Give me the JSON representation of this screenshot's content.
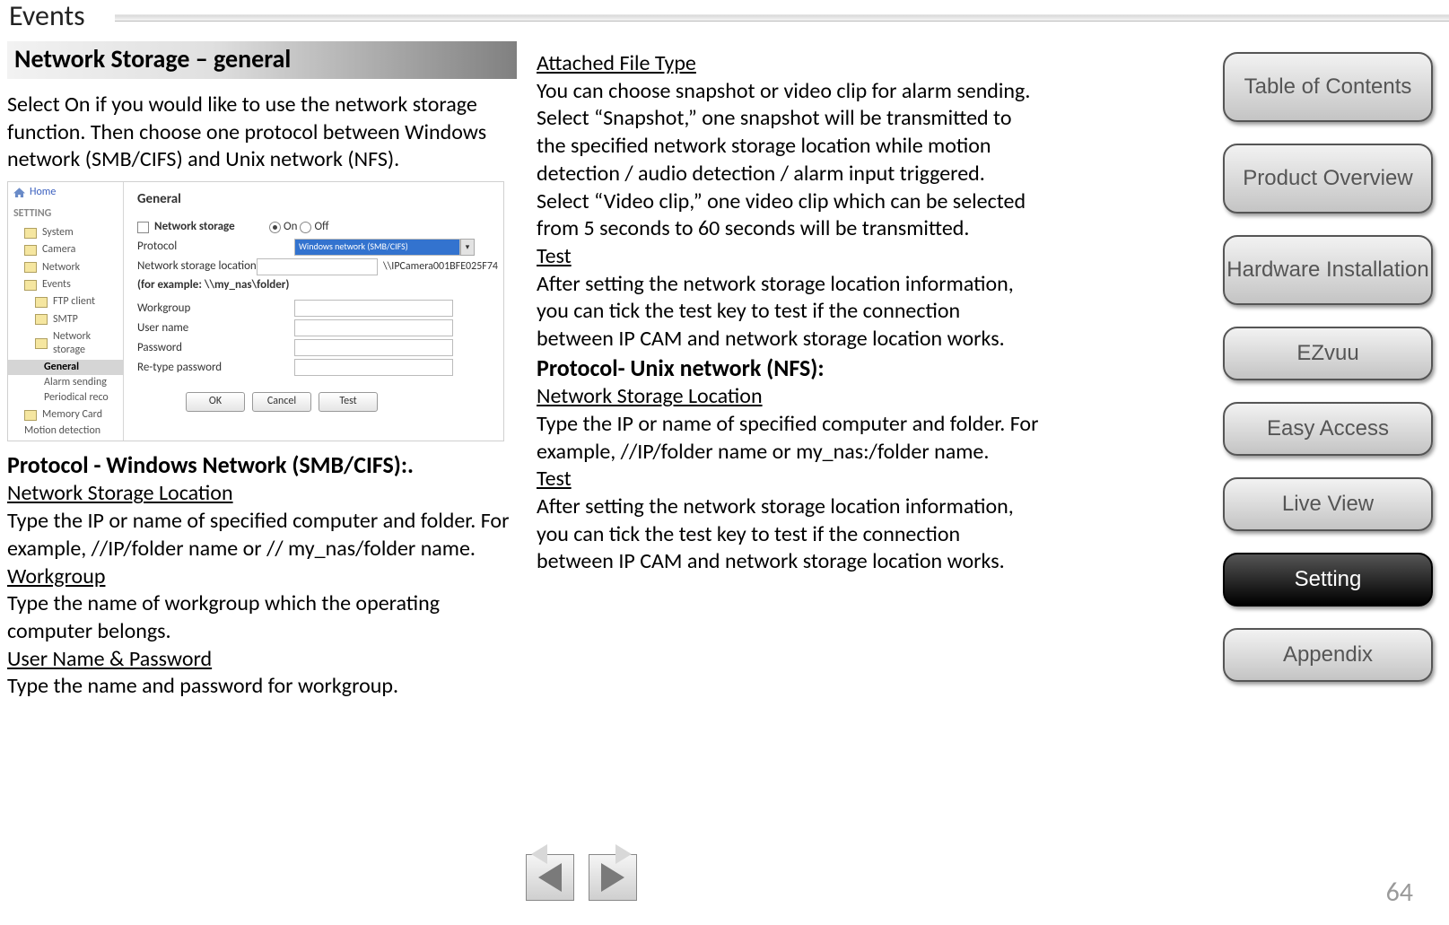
{
  "header": {
    "title": "Events"
  },
  "left": {
    "section_title": "Network Storage – general",
    "intro": "Select On if you would like to use the network storage function. Then choose one protocol between Windows network (SMB/CIFS) and Unix network (NFS).",
    "h_protocol_smb": "Protocol - Windows Network (SMB/CIFS):.",
    "h_nsl": "Network Storage Location",
    "p_nsl": "Type the IP or name of specified computer and folder. For example, //IP/folder name or // my_nas/folder name.",
    "h_wg": "Workgroup",
    "p_wg": "Type the name of workgroup which the operating computer belongs.",
    "h_up": "User Name & Password",
    "p_up": "Type the name and password for workgroup."
  },
  "right": {
    "h_aft": "Attached File Type",
    "p_aft": "You can choose snapshot or video clip for alarm sending. Select “Snapshot,” one snapshot will be transmitted to the specified network storage location while motion detection / audio detection / alarm input triggered. Select “Video clip,” one video clip which can be selected from 5 seconds to 60 seconds will be transmitted.",
    "h_test1": "Test",
    "p_test1": "After setting the network storage location information, you can tick the test key to test if the connection between IP CAM and network storage location works.",
    "h_nfs": "Protocol- Unix network (NFS):",
    "h_nsl2": "Network Storage Location",
    "p_nsl2": "Type the IP or name of specified computer and folder. For example, //IP/folder name or my_nas:/folder name.",
    "h_test2": "Test",
    "p_test2": "After setting the network storage location information, you can tick the test key to test if the connection between IP CAM and network storage location works."
  },
  "shot": {
    "side": {
      "home": "Home",
      "setting": "SETTING",
      "items": [
        "System",
        "Camera",
        "Network",
        "Events"
      ],
      "sub": [
        "FTP client",
        "SMTP",
        "Network storage"
      ],
      "ns_sub": [
        "General",
        "Alarm sending",
        "Periodical reco"
      ],
      "tail": [
        "Memory Card",
        "Motion detection"
      ]
    },
    "main": {
      "title": "General",
      "ns_label": "Network storage",
      "on": "On",
      "off": "Off",
      "protocol_lbl": "Protocol",
      "protocol_val": "Windows network (SMB/CIFS)",
      "nsl_lbl": "Network storage location",
      "nsl_val": "\\\\IPCamera001BFE025F74",
      "example": "(for example: \\\\my_nas\\folder)",
      "wg_lbl": "Workgroup",
      "un_lbl": "User name",
      "pw_lbl": "Password",
      "rpw_lbl": "Re-type password",
      "btn_ok": "OK",
      "btn_cancel": "Cancel",
      "btn_test": "Test"
    }
  },
  "nav": {
    "items": [
      {
        "label": "Table of Contents",
        "key": "toc",
        "lines": 2
      },
      {
        "label": "Product Overview",
        "key": "product",
        "lines": 2
      },
      {
        "label": "Hardware Installation",
        "key": "hw",
        "lines": 2
      },
      {
        "label": "EZvuu",
        "key": "ezvuu",
        "lines": 1
      },
      {
        "label": "Easy Access",
        "key": "easy",
        "lines": 1
      },
      {
        "label": "Live View",
        "key": "live",
        "lines": 1
      },
      {
        "label": "Setting",
        "key": "setting",
        "lines": 1,
        "active": true
      },
      {
        "label": "Appendix",
        "key": "appendix",
        "lines": 1
      }
    ]
  },
  "page_number": "64"
}
